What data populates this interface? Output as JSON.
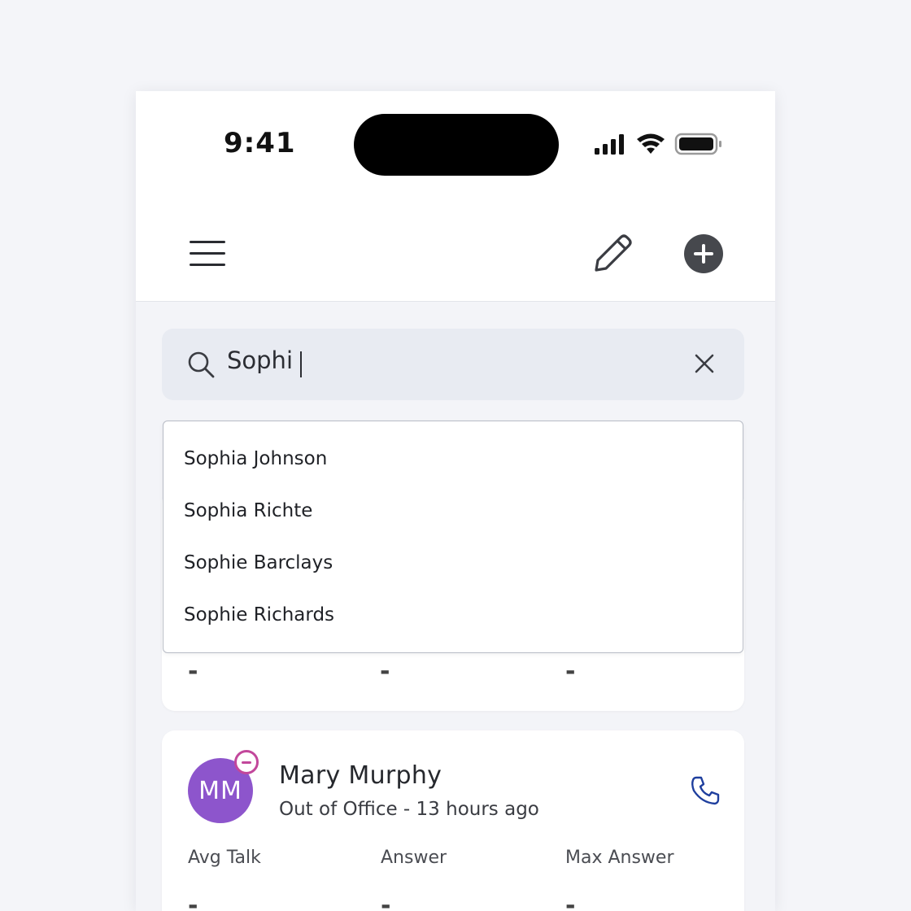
{
  "status_bar": {
    "time": "9:41"
  },
  "header": {
    "menu_icon": "hamburger-menu-icon",
    "edit_icon": "pencil-icon",
    "add_icon": "plus-circle-icon"
  },
  "search": {
    "value": "Sophi",
    "clear_icon": "close-icon",
    "search_icon": "search-icon"
  },
  "suggestions": [
    {
      "label": "Sophia Johnson"
    },
    {
      "label": "Sophia Richte"
    },
    {
      "label": "Sophie Barclays"
    },
    {
      "label": "Sophie Richards"
    }
  ],
  "card1": {
    "stats": [
      "-",
      "-",
      "-"
    ]
  },
  "card2": {
    "initials": "MM",
    "name": "Mary Murphy",
    "status": "Out of Office - 13 hours ago",
    "presence_color": "#c2479b",
    "avatar_color": "#8d55cc",
    "call_icon": "phone-icon",
    "stats": [
      {
        "label": "Avg Talk",
        "value": "-"
      },
      {
        "label": "Answer",
        "value": "-"
      },
      {
        "label": "Max Answer",
        "value": "-"
      }
    ]
  }
}
